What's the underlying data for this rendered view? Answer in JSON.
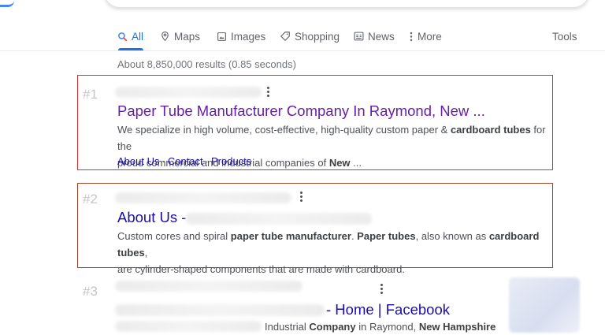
{
  "tabs": [
    {
      "label": "All",
      "icon": "search-icon",
      "active": true
    },
    {
      "label": "Maps",
      "icon": "map-pin-icon"
    },
    {
      "label": "Images",
      "icon": "image-icon"
    },
    {
      "label": "Shopping",
      "icon": "tag-icon"
    },
    {
      "label": "News",
      "icon": "news-icon"
    },
    {
      "label": "More",
      "icon": "more-vert-icon"
    }
  ],
  "tools_label": "Tools",
  "stats": "About 8,850,000 results (0.85 seconds)",
  "results": [
    {
      "rank": "#1",
      "title": "Paper Tube Manufacturer Company In Raymond, New ...",
      "snippet_line1": [
        "We specialize in high volume, cost-effective, high-quality custom paper & ",
        "cardboard tubes",
        " for the"
      ],
      "snippet_line2": [
        "proud commercial and industrial companies of ",
        "New",
        " ..."
      ],
      "sitelinks": [
        "About Us",
        "Contact",
        "Products"
      ],
      "sitelink_separator": "·"
    },
    {
      "rank": "#2",
      "title": "About Us -",
      "snippet_line1": [
        "Custom cores and spiral ",
        "paper tube manufacturer",
        ". ",
        "Paper tubes",
        ", also known as ",
        "cardboard tubes",
        ","
      ],
      "snippet_line2": "are cylinder-shaped components that are made with cardboard."
    },
    {
      "rank": "#3",
      "title": "- Home | Facebook",
      "snippet_line1": [
        "Industrial ",
        "Company",
        " in Raymond, ",
        "New Hampshire"
      ]
    }
  ],
  "colors": {
    "accent": "#1a73e8",
    "visited_link": "#681da8",
    "link": "#1a0dab",
    "highlight_box_1": "#d93030",
    "highlight_box_2": "#a0422a"
  }
}
